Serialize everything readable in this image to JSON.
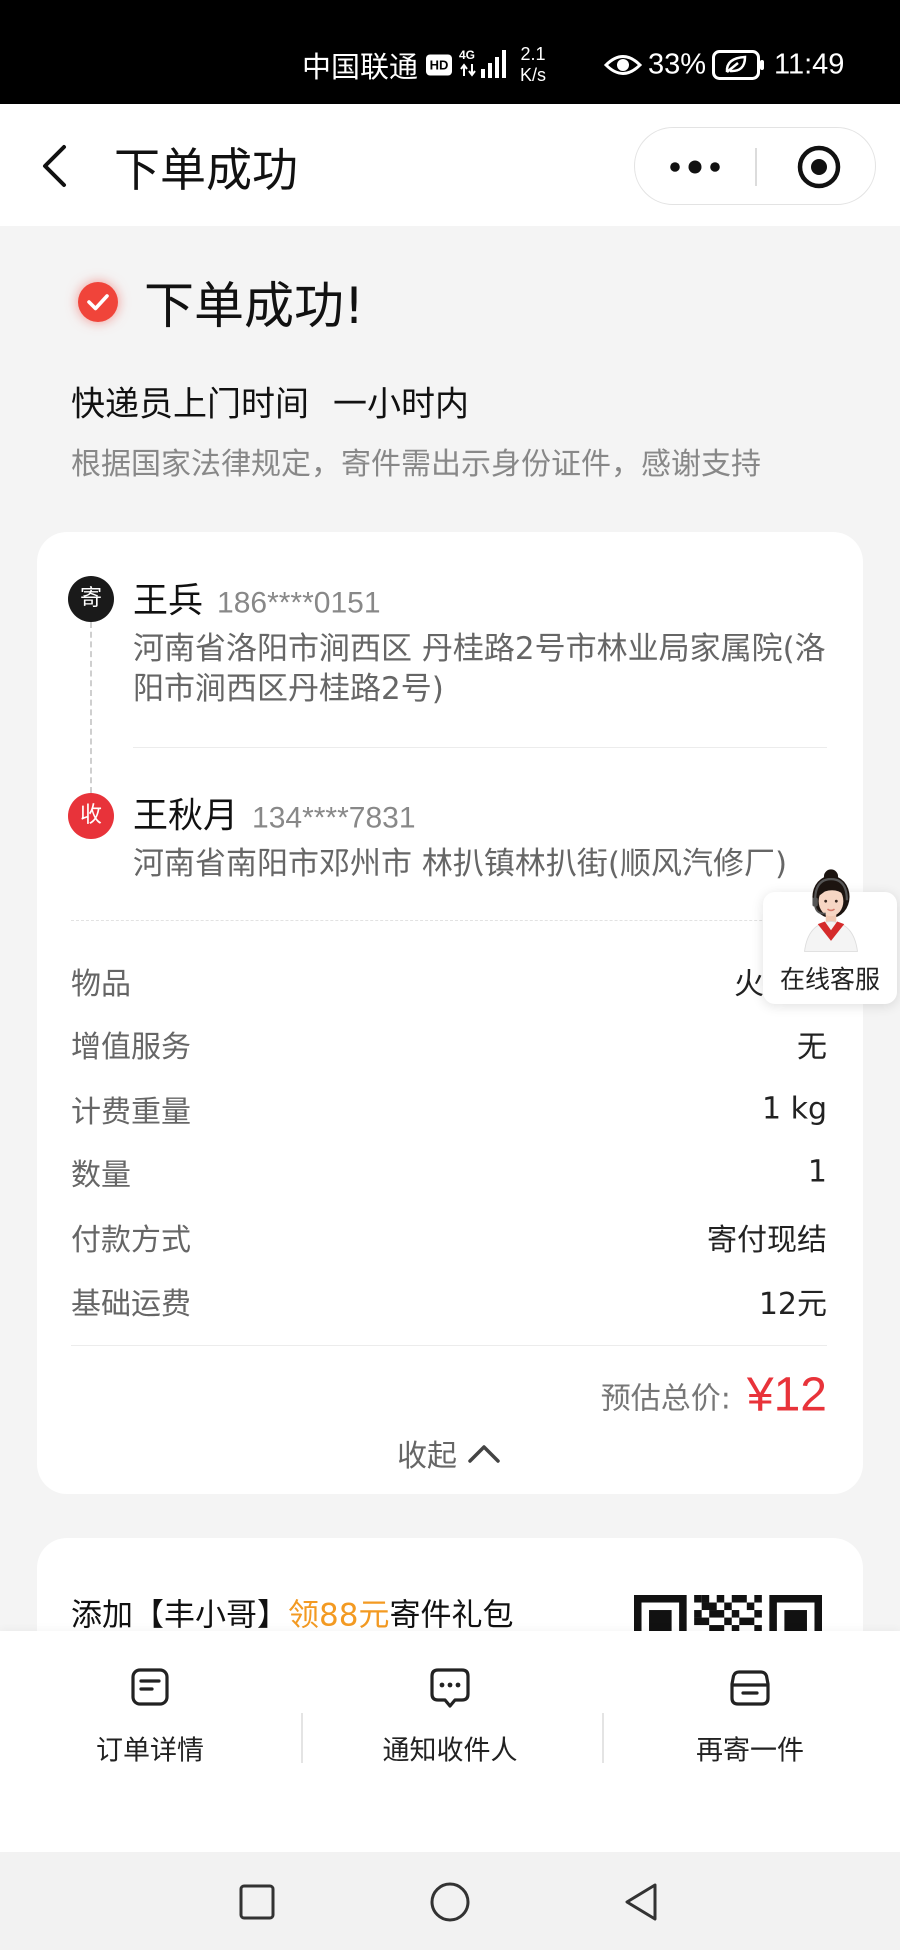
{
  "status_bar": {
    "carrier": "中国联通",
    "hd": "HD",
    "network": "4G",
    "speed_value": "2.1",
    "speed_unit": "K/s",
    "battery": "33%",
    "time": "11:49",
    "icons": [
      "signal-icon",
      "eye-icon",
      "battery-saver-icon"
    ]
  },
  "header": {
    "title": "下单成功",
    "icons": [
      "back-icon",
      "more-icon",
      "target-icon"
    ]
  },
  "success": {
    "title": "下单成功!",
    "pickup_label": "快递员上门时间",
    "pickup_value": "一小时内",
    "notice": "根据国家法律规定，寄件需出示身份证件，感谢支持",
    "icon": "check-circle-icon"
  },
  "sender": {
    "badge": "寄",
    "name": "王兵",
    "phone": "186****0151",
    "address": "河南省洛阳市涧西区 丹桂路2号市林业局家属院(洛阳市涧西区丹桂路2号)"
  },
  "receiver": {
    "badge": "收",
    "name": "王秋月",
    "phone": "134****7831",
    "address": "河南省南阳市邓州市 林扒镇林扒街(顺风汽修厂)"
  },
  "details": [
    {
      "label": "物品",
      "value": "火"
    },
    {
      "label": "增值服务",
      "value": "无"
    },
    {
      "label": "计费重量",
      "value": "1 kg"
    },
    {
      "label": "数量",
      "value": "1"
    },
    {
      "label": "付款方式",
      "value": "寄付现结"
    },
    {
      "label": "基础运费",
      "value": "12元"
    }
  ],
  "total": {
    "label": "预估总价:",
    "value": "¥12"
  },
  "collapse": {
    "label": "收起",
    "icon": "chevron-up-icon"
  },
  "customer_service": {
    "label": "在线客服",
    "icon": "agent-avatar"
  },
  "promo": {
    "prefix": "添加【丰小哥】",
    "highlight": "领88元",
    "suffix": "寄件礼包",
    "icon": "qr-code"
  },
  "actions": [
    {
      "label": "订单详情",
      "icon": "order-detail-icon"
    },
    {
      "label": "通知收件人",
      "icon": "message-icon"
    },
    {
      "label": "再寄一件",
      "icon": "box-icon"
    }
  ],
  "nav": {
    "icons": [
      "recent-apps-icon",
      "home-icon",
      "back-nav-icon"
    ]
  },
  "colors": {
    "accent": "#e8333a",
    "promo": "#f39a22",
    "success": "#f0443a",
    "sender_badge": "#1a1a1a"
  }
}
